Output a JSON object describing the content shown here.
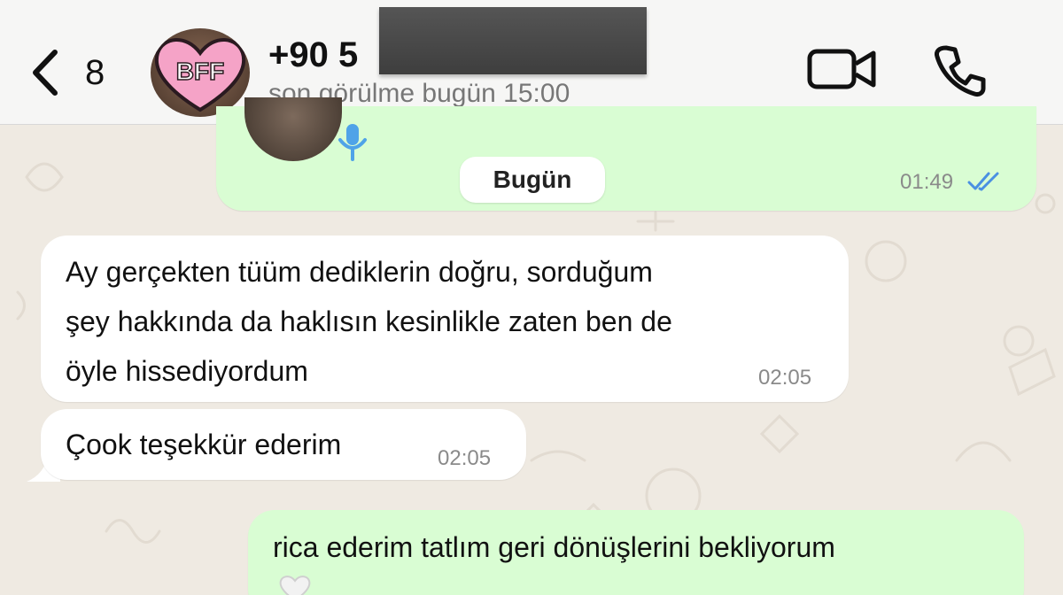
{
  "header": {
    "back_count": "8",
    "avatar_text": "BFF",
    "contact_name": "+90 5",
    "last_seen": "son görülme bugün 15:00"
  },
  "messages": {
    "top_outgoing_time": "01:49",
    "date_divider": "Bugün",
    "msg1": {
      "lines": [
        "Ay gerçekten tüüm dediklerin doğru, sorduğum",
        "şey hakkında da haklısın kesinlikle zaten ben de",
        "öyle hissediyordum"
      ],
      "time": "02:05"
    },
    "msg2": {
      "text": "Çook teşekkür ederim",
      "time": "02:05"
    },
    "msg3": {
      "text": "rica ederim tatlım geri dönüşlerini bekliyorum"
    }
  },
  "colors": {
    "incoming_bubble": "#ffffff",
    "outgoing_bubble": "#d9fdd3",
    "chat_background": "#efeae2",
    "read_ticks": "#4a90e2",
    "avatar_heart": "#f5a3c7"
  },
  "icons": [
    "chevron-left-icon",
    "video-call-icon",
    "phone-icon",
    "microphone-icon",
    "double-check-icon",
    "white-heart-icon"
  ]
}
